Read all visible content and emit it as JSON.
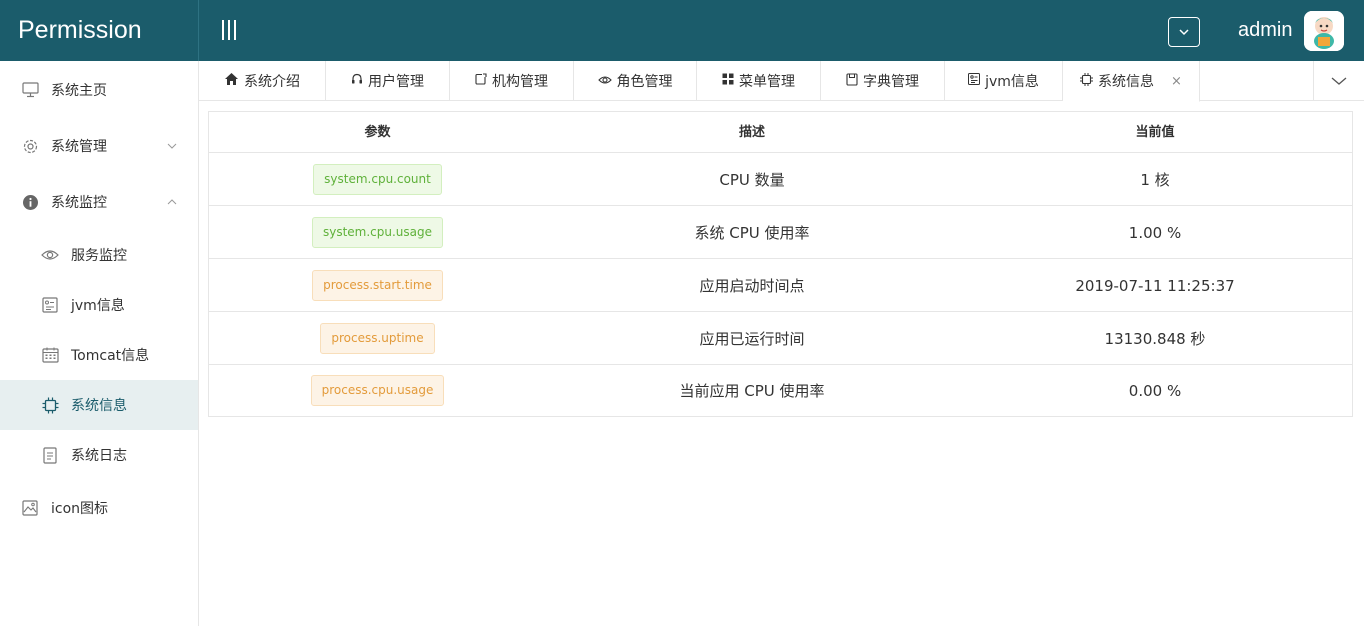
{
  "app": {
    "brand": "Permission",
    "username": "admin"
  },
  "sidebar": {
    "items": [
      {
        "label": "系统主页",
        "icon": "monitor-icon"
      },
      {
        "label": "系统管理",
        "icon": "gear-icon",
        "expanded": false
      },
      {
        "label": "系统监控",
        "icon": "info-icon",
        "expanded": true
      },
      {
        "label": "服务监控",
        "icon": "eye-icon"
      },
      {
        "label": "jvm信息",
        "icon": "jvm-icon"
      },
      {
        "label": "Tomcat信息",
        "icon": "calendar-icon"
      },
      {
        "label": "系统信息",
        "icon": "chip-icon",
        "active": true
      },
      {
        "label": "系统日志",
        "icon": "document-icon"
      },
      {
        "label": "icon图标",
        "icon": "image-icon"
      }
    ]
  },
  "tabs": [
    {
      "label": "系统介绍",
      "icon": "home-icon"
    },
    {
      "label": "用户管理",
      "icon": "headset-icon"
    },
    {
      "label": "机构管理",
      "icon": "org-icon"
    },
    {
      "label": "角色管理",
      "icon": "eye-icon"
    },
    {
      "label": "菜单管理",
      "icon": "grid-icon"
    },
    {
      "label": "字典管理",
      "icon": "save-icon"
    },
    {
      "label": "jvm信息",
      "icon": "jvm-icon"
    },
    {
      "label": "系统信息",
      "icon": "chip-icon",
      "active": true,
      "close": "×"
    }
  ],
  "table": {
    "headers": [
      "参数",
      "描述",
      "当前值"
    ],
    "rows": [
      {
        "param": "system.cpu.count",
        "tag_color": "green",
        "desc": "CPU 数量",
        "value": "1 核"
      },
      {
        "param": "system.cpu.usage",
        "tag_color": "green",
        "desc": "系统 CPU 使用率",
        "value": "1.00 %"
      },
      {
        "param": "process.start.time",
        "tag_color": "orange",
        "desc": "应用启动时间点",
        "value": "2019-07-11 11:25:37"
      },
      {
        "param": "process.uptime",
        "tag_color": "orange",
        "desc": "应用已运行时间",
        "value": "13130.848 秒"
      },
      {
        "param": "process.cpu.usage",
        "tag_color": "orange",
        "desc": "当前应用 CPU 使用率",
        "value": "0.00 %"
      }
    ]
  },
  "colors": {
    "header_bg": "#1b5c6b",
    "active_menu_bg": "#e7eff0",
    "tag_green": "#5fb13a",
    "tag_orange": "#e39b3b"
  }
}
